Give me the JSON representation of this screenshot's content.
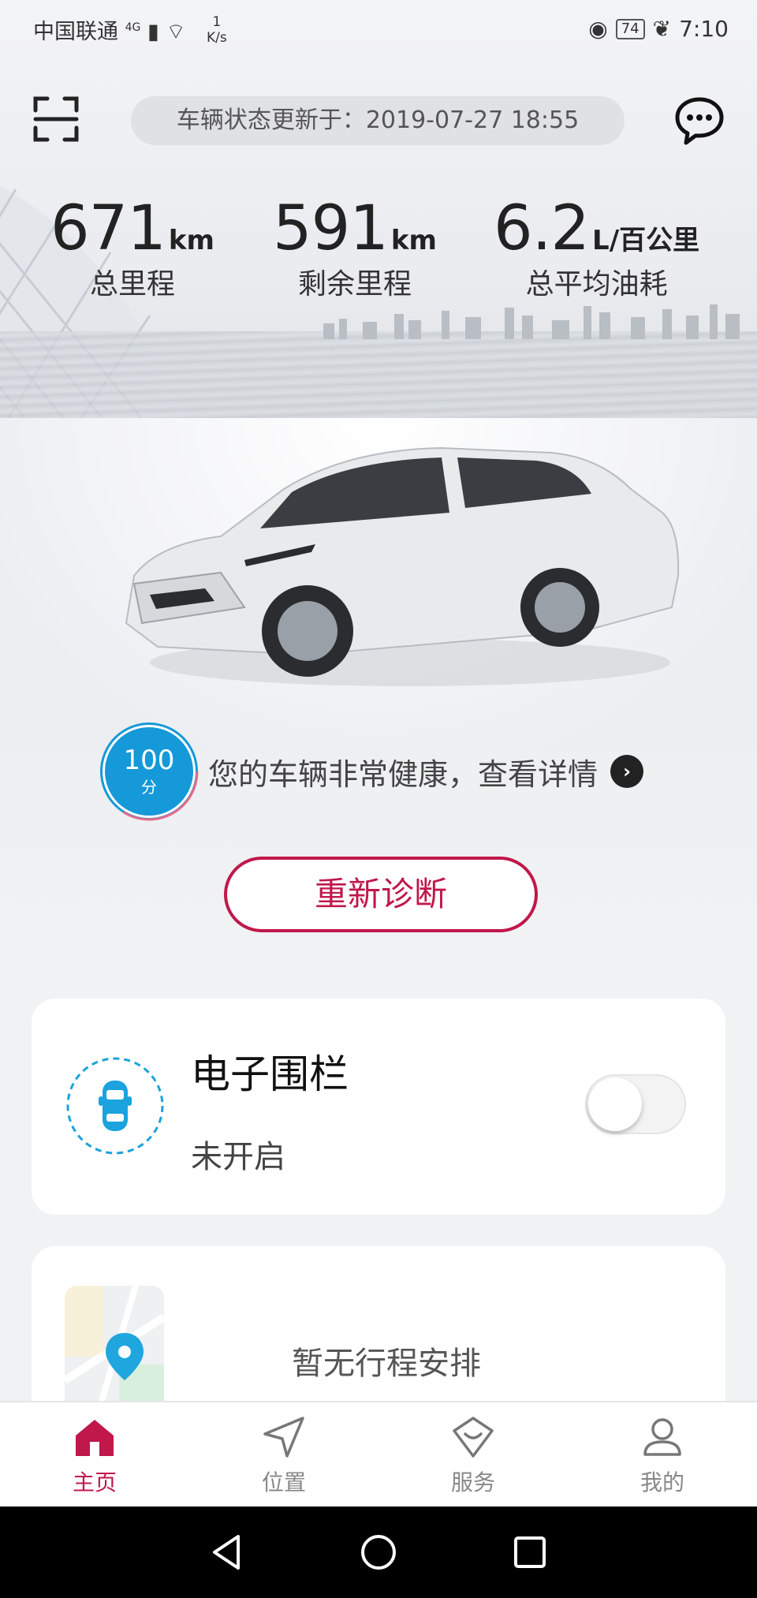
{
  "status_bar": {
    "carrier": "中国联通",
    "network": "4G",
    "speed_value": "1",
    "speed_unit": "K/s",
    "battery": "74",
    "time": "7:10"
  },
  "header": {
    "update_text": "车辆状态更新于：2019-07-27 18:55",
    "scan_icon": "scan-icon",
    "message_icon": "chat-bubble-icon"
  },
  "stats": [
    {
      "value": "671",
      "unit": "km",
      "label": "总里程"
    },
    {
      "value": "591",
      "unit": "km",
      "label": "剩余里程"
    },
    {
      "value": "6.2",
      "unit": "L/百公里",
      "label": "总平均油耗"
    }
  ],
  "health": {
    "score": "100",
    "score_unit": "分",
    "text": "您的车辆非常健康，查看详情",
    "accent": "#1599d8"
  },
  "rediagnose": {
    "label": "重新诊断"
  },
  "fence_card": {
    "title": "电子围栏",
    "status": "未开启",
    "toggle_on": false
  },
  "trip_card": {
    "text": "暂无行程安排"
  },
  "tabs": [
    {
      "label": "主页",
      "icon": "home-icon",
      "active": true
    },
    {
      "label": "位置",
      "icon": "location-arrow-icon",
      "active": false
    },
    {
      "label": "服务",
      "icon": "service-icon",
      "active": false
    },
    {
      "label": "我的",
      "icon": "profile-icon",
      "active": false
    }
  ],
  "colors": {
    "brand": "#c0184a",
    "accent_blue": "#1599d8"
  }
}
